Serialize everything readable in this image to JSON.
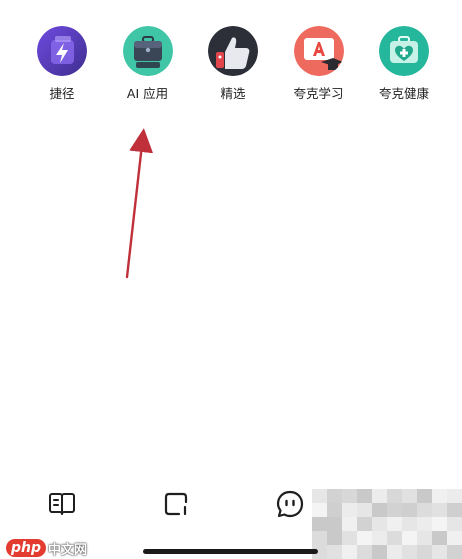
{
  "apps": [
    {
      "label": "捷径",
      "icon": "shortcut-bolt-icon"
    },
    {
      "label": "AI 应用",
      "icon": "ai-briefcase-icon"
    },
    {
      "label": "精选",
      "icon": "thumbs-up-icon"
    },
    {
      "label": "夸克学习",
      "icon": "study-board-icon"
    },
    {
      "label": "夸克健康",
      "icon": "health-kit-icon"
    }
  ],
  "bottom_nav": [
    {
      "name": "book-icon"
    },
    {
      "name": "tabs-icon"
    },
    {
      "name": "assistant-face-icon"
    }
  ],
  "annotation": {
    "color": "#c0303a",
    "points_to": "AI 应用"
  },
  "watermark": {
    "logo": "php",
    "site": "中文网"
  }
}
